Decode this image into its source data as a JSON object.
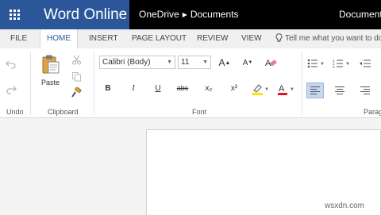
{
  "app": {
    "name": "Word Online",
    "breadcrumb": [
      "OneDrive",
      "Documents"
    ],
    "document_title": "Document"
  },
  "tabs": [
    "FILE",
    "HOME",
    "INSERT",
    "PAGE LAYOUT",
    "REVIEW",
    "VIEW"
  ],
  "active_tab": "HOME",
  "tell_me": "Tell me what you want to do",
  "groups": {
    "undo": "Undo",
    "clipboard": "Clipboard",
    "font": "Font",
    "paragraph": "Paragraph"
  },
  "clipboard": {
    "paste_label": "Paste"
  },
  "font": {
    "family": "Calibri (Body)",
    "size": "11"
  },
  "format_buttons": {
    "bold": "B",
    "italic": "I",
    "underline": "U",
    "strikethrough": "abc",
    "subscript": "x₂",
    "superscript": "x²"
  },
  "watermark": "wsxdn.com",
  "colors": {
    "brand_blue": "#2b579a",
    "header_bg": "#000000",
    "highlight": "#ffe600",
    "font_color": "#e81123",
    "align_active": "#c5d7ee"
  }
}
